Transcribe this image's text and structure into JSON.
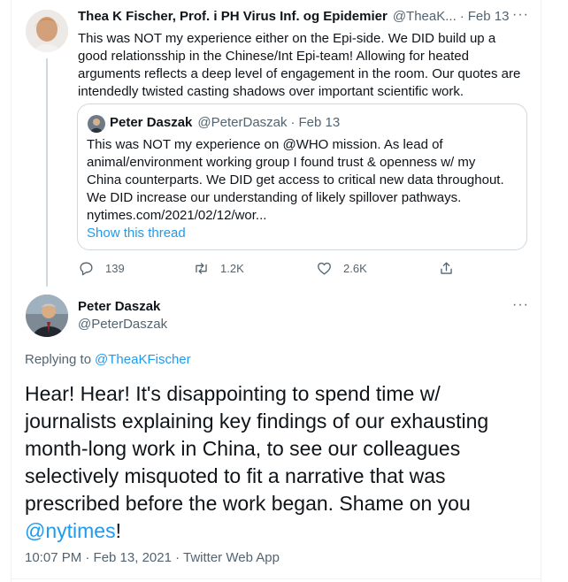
{
  "parent_tweet": {
    "author_name": "Thea K Fischer, Prof. i PH Virus Inf. og Epidemier",
    "handle": "@TheaK...",
    "separator": "·",
    "date": "Feb 13",
    "more_label": "···",
    "text": "This was NOT my experience either on the Epi-side. We DID build up a good relationsship in the Chinese/Int Epi-team! Allowing for heated arguments reflects a deep level of engagement in the room. Our quotes are intendedly twisted casting shadows over important scientific work.",
    "quote": {
      "author_name": "Peter Daszak",
      "handle": "@PeterDaszak",
      "separator": "·",
      "date": "Feb 13",
      "text": "This was NOT my experience on @WHO mission. As lead of animal/environment working group I found trust & openness w/ my China counterparts. We DID get access to critical new data throughout. We DID increase our understanding of likely spillover pathways. nytimes.com/2021/02/12/wor...",
      "show_thread_label": "Show this thread"
    },
    "actions": {
      "replies": "139",
      "retweets": "1.2K",
      "likes": "2.6K"
    }
  },
  "main_tweet": {
    "author_name": "Peter Daszak",
    "handle": "@PeterDaszak",
    "more_label": "···",
    "replying_prefix": "Replying to",
    "replying_handle": "@TheaKFischer",
    "text": "Hear! Hear! It's disappointing to spend time w/ journalists explaining key findings of our exhausting month-long work in China, to see our colleagues selectively misquoted to fit a narrative that was prescribed before the work began. Shame on you",
    "mention": "@nytimes",
    "text_end": "!",
    "timestamp": "10:07 PM · Feb 13, 2021 · Twitter Web App"
  },
  "colors": {
    "link": "#1d9bf0",
    "muted": "#536471",
    "border": "#cfd9de"
  },
  "icons": [
    "reply-icon",
    "retweet-icon",
    "like-icon",
    "share-icon",
    "more-icon"
  ]
}
